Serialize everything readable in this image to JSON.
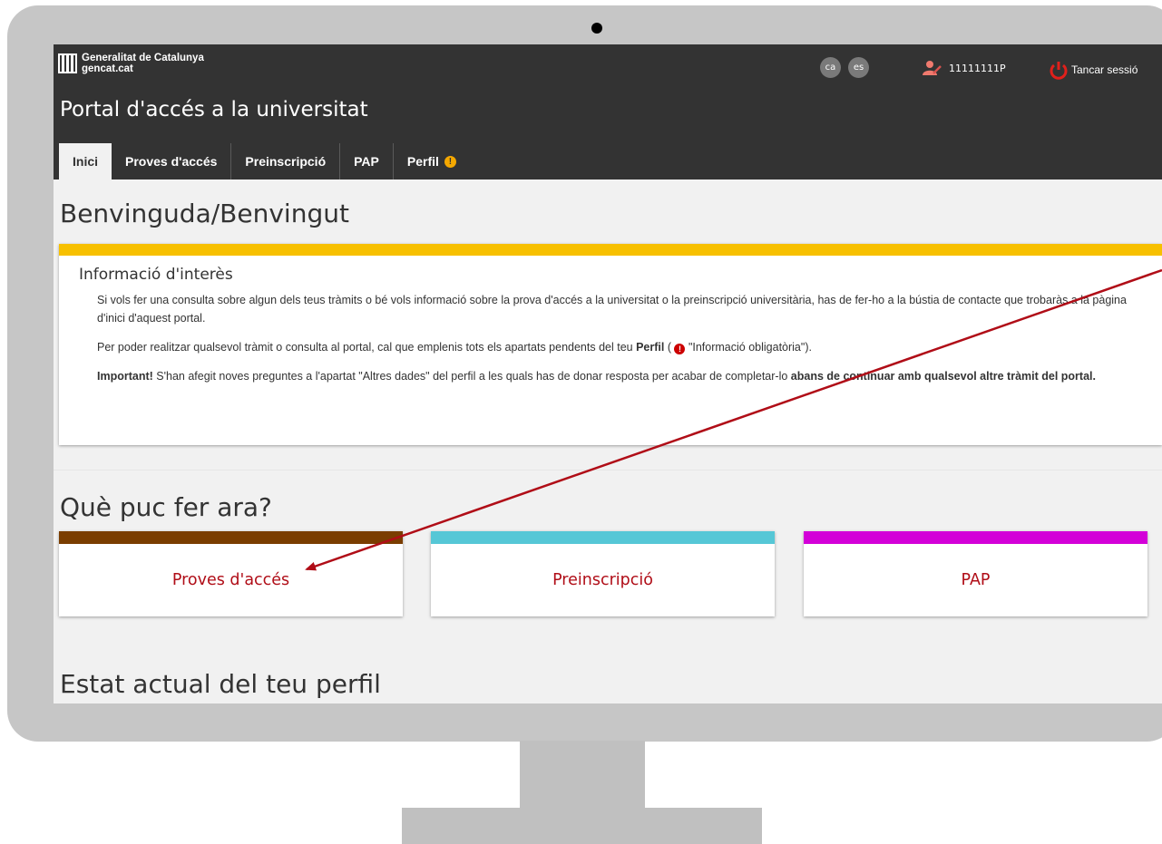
{
  "header": {
    "logo_line1": "Generalitat de Catalunya",
    "logo_line2": "gencat.cat",
    "languages": [
      "ca",
      "es"
    ],
    "user_id": "11111111P",
    "logout_label": "Tancar sessió",
    "portal_title": "Portal d'accés a la universitat"
  },
  "nav": {
    "tabs": [
      {
        "label": "Inici",
        "active": true
      },
      {
        "label": "Proves d'accés",
        "active": false
      },
      {
        "label": "Preinscripció",
        "active": false
      },
      {
        "label": "PAP",
        "active": false
      },
      {
        "label": "Perfil",
        "active": false,
        "warning_icon": "exclamation-circle-icon"
      }
    ]
  },
  "main": {
    "welcome_title": "Benvinguda/Benvingut",
    "info": {
      "title": "Informació d'interès",
      "p1": "Si vols fer una consulta sobre algun dels teus tràmits o bé vols informació sobre la prova d'accés a la universitat o la preinscripció universitària, has de fer-ho a la bústia de contacte que trobaràs a la pàgina d'inici d'aquest portal.",
      "p2_before": "Per poder realitzar qualsevol tràmit o consulta al portal, cal que emplenis tots els apartats pendents del teu ",
      "p2_bold": "Perfil",
      "p2_mid": " ( ",
      "p2_after": " \"Informació obligatòria\").",
      "p3_bold1": "Important!",
      "p3_text": " S'han afegit noves preguntes a l'apartat \"Altres dades\" del perfil a les quals has de donar resposta per acabar de completar-lo ",
      "p3_bold2": "abans de continuar amb qualsevol altre tràmit del portal.",
      "accent_color": "#f7c000"
    },
    "actions_title": "Què puc fer ara?",
    "actions": [
      {
        "label": "Proves d'accés",
        "color": "#7a3d00"
      },
      {
        "label": "Preinscripció",
        "color": "#56c7d6"
      },
      {
        "label": "PAP",
        "color": "#d300d8"
      }
    ],
    "profile_title": "Estat actual del teu perfil"
  },
  "annotation": {
    "arrow_color": "#b00d17"
  }
}
